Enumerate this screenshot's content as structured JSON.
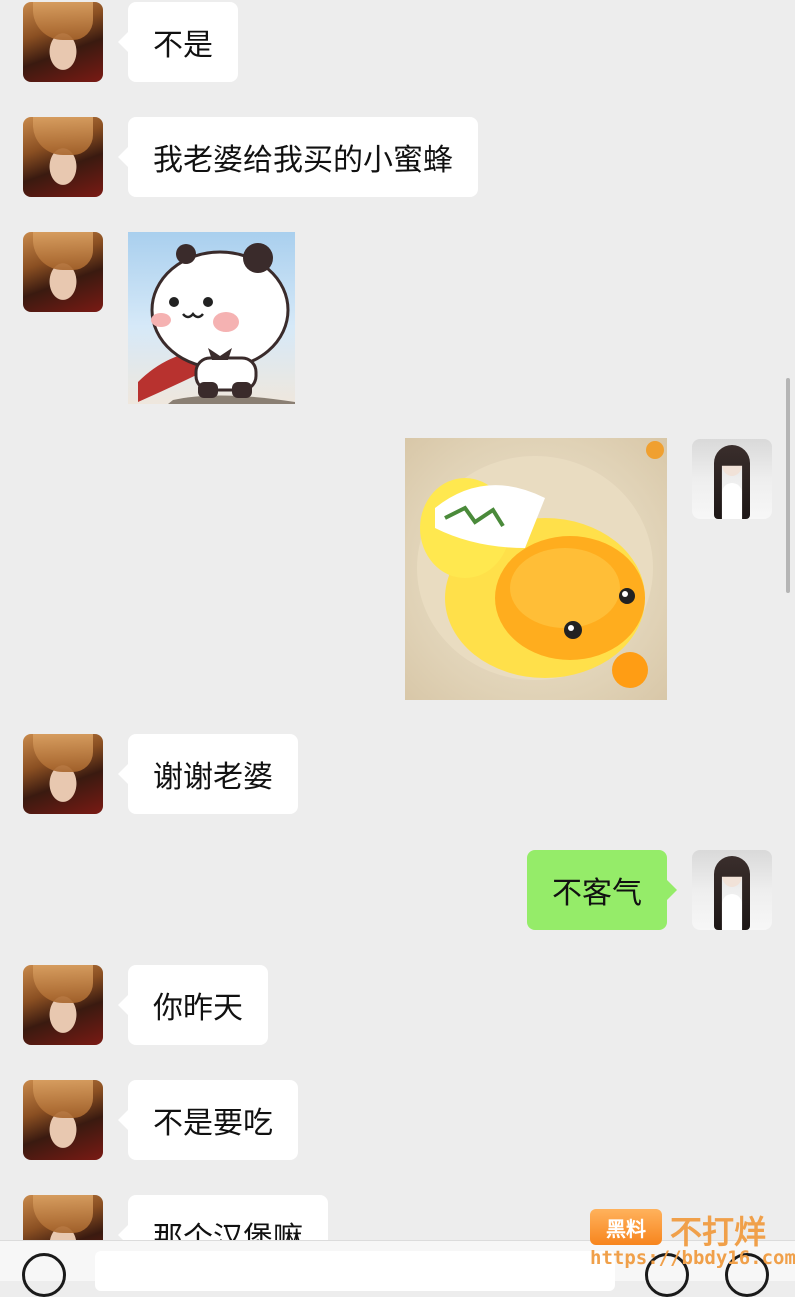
{
  "messages": [
    {
      "side": "left",
      "text": "不是"
    },
    {
      "side": "left",
      "text": "我老婆给我买的小蜜蜂"
    },
    {
      "side": "left",
      "sticker": "panda-hero-sticker"
    },
    {
      "side": "right",
      "sticker": "yellow-duck-sticker"
    },
    {
      "side": "left",
      "text": "谢谢老婆"
    },
    {
      "side": "right",
      "text": "不客气"
    },
    {
      "side": "left",
      "text": "你昨天"
    },
    {
      "side": "left",
      "text": "不是要吃"
    },
    {
      "side": "left",
      "text": "那个汉堡嘛"
    }
  ],
  "watermark": {
    "logo": "黑料",
    "name": "不打烊",
    "url": "https://bbdy16.com"
  },
  "colors": {
    "background": "#ededed",
    "incoming_bubble": "#ffffff",
    "outgoing_bubble": "#95ec69"
  }
}
